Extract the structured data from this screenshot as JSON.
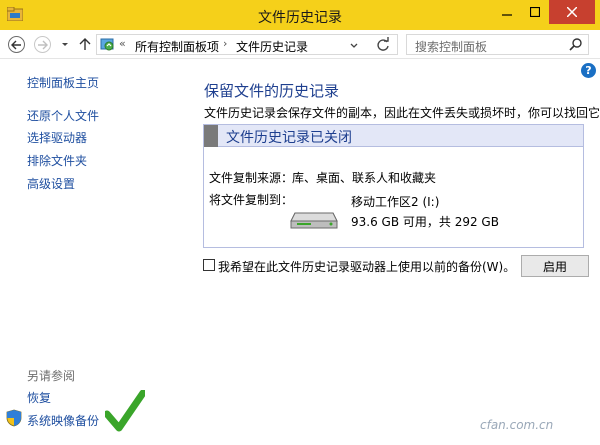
{
  "window": {
    "title": "文件历史记录"
  },
  "toolbar": {
    "breadcrumb_sep": "«",
    "breadcrumb_arrow": "›",
    "breadcrumb": [
      "所有控制面板项",
      "文件历史记录"
    ],
    "search_placeholder": "搜索控制面板"
  },
  "sidebar": {
    "home": "控制面板主页",
    "items": [
      "还原个人文件",
      "选择驱动器",
      "排除文件夹",
      "高级设置"
    ],
    "see_also_title": "另请参阅",
    "see_also": [
      "恢复",
      "系统映像备份"
    ]
  },
  "main": {
    "heading": "保留文件的历史记录",
    "description": "文件历史记录会保存文件的副本，因此在文件丢失或损坏时，你可以找回它们。",
    "status": {
      "title": "文件历史记录已关闭",
      "source_label": "文件复制来源：",
      "source_value": "库、桌面、联系人和收藏夹",
      "dest_label": "将文件复制到：",
      "drive_name": "移动工作区2 (I:)",
      "drive_space": "93.6 GB 可用，共 292 GB"
    },
    "checkbox_label": "我希望在此文件历史记录驱动器上使用以前的备份(W)。",
    "checkbox_checked": false,
    "enable_button": "启用"
  },
  "watermark": "cfan.com.cn",
  "colors": {
    "titlebar": "#f5d01a",
    "close": "#c7402f",
    "link": "#1f4fa0",
    "heading": "#1e3f8f",
    "check": "#3aa52a"
  },
  "icons": [
    "app-icon",
    "back-arrow-icon",
    "forward-arrow-icon",
    "chevron-down-icon",
    "up-arrow-icon",
    "control-panel-icon",
    "refresh-icon",
    "search-icon",
    "help-icon",
    "drive-icon",
    "shield-icon",
    "checkmark-icon"
  ]
}
